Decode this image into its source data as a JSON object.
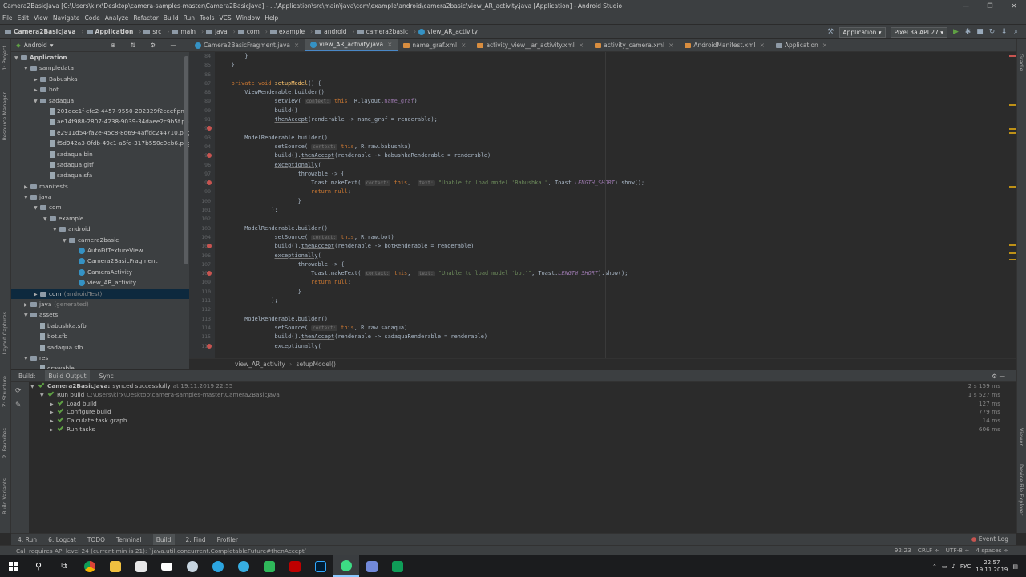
{
  "window": {
    "title": "Camera2BasicJava [C:\\Users\\kirx\\Desktop\\camera-samples-master\\Camera2BasicJava] - ...\\Application\\src\\main\\java\\com\\example\\android\\camera2basic\\view_AR_activity.java [Application] - Android Studio"
  },
  "menu": [
    "File",
    "Edit",
    "View",
    "Navigate",
    "Code",
    "Analyze",
    "Refactor",
    "Build",
    "Run",
    "Tools",
    "VCS",
    "Window",
    "Help"
  ],
  "nav": {
    "crumbs": [
      "Camera2BasicJava",
      "Application",
      "src",
      "main",
      "java",
      "com",
      "example",
      "android",
      "camera2basic",
      "view_AR_activity"
    ]
  },
  "run": {
    "config": "Application",
    "device": "Pixel 3a API 27"
  },
  "project": {
    "view": "Android"
  },
  "tree": [
    {
      "t": "Application",
      "d": 0,
      "a": "▼",
      "bold": true
    },
    {
      "t": "sampledata",
      "d": 1,
      "a": "▼"
    },
    {
      "t": "Babushka",
      "d": 2,
      "a": "▶"
    },
    {
      "t": "bot",
      "d": 2,
      "a": "▶"
    },
    {
      "t": "sadaqua",
      "d": 2,
      "a": "▼"
    },
    {
      "t": "201dcc1f-efe2-4457-9550-202329f2ceef.png",
      "d": 3,
      "a": ""
    },
    {
      "t": "ae14f988-2807-4238-9039-34daee2c9b5f.png",
      "d": 3,
      "a": ""
    },
    {
      "t": "e2911d54-fa2e-45c8-8d69-4affdc244710.png",
      "d": 3,
      "a": ""
    },
    {
      "t": "f5d942a3-0fdb-49c1-a6fd-317b550c0eb6.png",
      "d": 3,
      "a": ""
    },
    {
      "t": "sadaqua.bin",
      "d": 3,
      "a": ""
    },
    {
      "t": "sadaqua.gltf",
      "d": 3,
      "a": ""
    },
    {
      "t": "sadaqua.sfa",
      "d": 3,
      "a": ""
    },
    {
      "t": "manifests",
      "d": 1,
      "a": "▶"
    },
    {
      "t": "java",
      "d": 1,
      "a": "▼"
    },
    {
      "t": "com",
      "d": 2,
      "a": "▼"
    },
    {
      "t": "example",
      "d": 3,
      "a": "▼"
    },
    {
      "t": "android",
      "d": 4,
      "a": "▼"
    },
    {
      "t": "camera2basic",
      "d": 5,
      "a": "▼"
    },
    {
      "t": "AutoFitTextureView",
      "d": 6,
      "a": ""
    },
    {
      "t": "Camera2BasicFragment",
      "d": 6,
      "a": ""
    },
    {
      "t": "CameraActivity",
      "d": 6,
      "a": ""
    },
    {
      "t": "view_AR_activity",
      "d": 6,
      "a": ""
    },
    {
      "t": "com",
      "s": "(androidTest)",
      "d": 2,
      "a": "▶",
      "sel": true
    },
    {
      "t": "java",
      "s": "(generated)",
      "d": 1,
      "a": "▶"
    },
    {
      "t": "assets",
      "d": 1,
      "a": "▼"
    },
    {
      "t": "babushka.sfb",
      "d": 2,
      "a": ""
    },
    {
      "t": "bot.sfb",
      "d": 2,
      "a": ""
    },
    {
      "t": "sadaqua.sfb",
      "d": 2,
      "a": ""
    },
    {
      "t": "res",
      "d": 1,
      "a": "▼"
    },
    {
      "t": "drawable",
      "d": 2,
      "a": ""
    }
  ],
  "tabs": [
    {
      "label": "Camera2BasicFragment.java",
      "active": false
    },
    {
      "label": "view_AR_activity.java",
      "active": true
    },
    {
      "label": "name_graf.xml",
      "active": false
    },
    {
      "label": "activity_view__ar_activity.xml",
      "active": false
    },
    {
      "label": "activity_camera.xml",
      "active": false
    },
    {
      "label": "AndroidManifest.xml",
      "active": false
    },
    {
      "label": "Application",
      "active": false
    }
  ],
  "lines": [
    "84",
    "85",
    "86",
    "87",
    "88",
    "89",
    "90",
    "91",
    "92",
    "93",
    "94",
    "95",
    "96",
    "97",
    "98",
    "99",
    "100",
    "101",
    "102",
    "103",
    "104",
    "105",
    "106",
    "107",
    "108",
    "109",
    "110",
    "111",
    "112",
    "113",
    "114",
    "115",
    "116"
  ],
  "code": [
    "        }",
    "    }",
    "",
    "    private void setupModel() {",
    "        ViewRenderable.builder()",
    "                .setView( context: this, R.layout.name_graf)",
    "                .build()",
    "                .thenAccept(renderable -> name_graf = renderable);",
    "",
    "        ModelRenderable.builder()",
    "                .setSource( context: this, R.raw.babushka)",
    "                .build().thenAccept(renderable -> babushkaRenderable = renderable)",
    "                .exceptionally(",
    "                        throwable -> {",
    "                            Toast.makeText( context: this,  text: \"Unable to load model 'Babushka'\", Toast.LENGTH_SHORT).show();",
    "                            return null;",
    "                        }",
    "                );",
    "",
    "        ModelRenderable.builder()",
    "                .setSource( context: this, R.raw.bot)",
    "                .build().thenAccept(renderable -> botRenderable = renderable)",
    "                .exceptionally(",
    "                        throwable -> {",
    "                            Toast.makeText( context: this,  text: \"Unable to load model 'bot'\", Toast.LENGTH_SHORT).show();",
    "                            return null;",
    "                        }",
    "                );",
    "",
    "        ModelRenderable.builder()",
    "                .setSource( context: this, R.raw.sadaqua)",
    "                .build().thenAccept(renderable -> sadaquaRenderable = renderable)",
    "                .exceptionally("
  ],
  "editorCrumb": [
    "view_AR_activity",
    "setupModel()"
  ],
  "build": {
    "tabs": [
      "Build:",
      "Build Output",
      "Sync"
    ],
    "rows": [
      {
        "t": "Camera2BasicJava:",
        "s": "synced successfully",
        "g": "at 19.11.2019 22:55",
        "time": "2 s 159 ms",
        "d": 0
      },
      {
        "t": "Run build",
        "g": "C:\\Users\\kirx\\Desktop\\camera-samples-master\\Camera2BasicJava",
        "time": "1 s 527 ms",
        "d": 1
      },
      {
        "t": "Load build",
        "time": "127 ms",
        "d": 2
      },
      {
        "t": "Configure build",
        "time": "779 ms",
        "d": 2
      },
      {
        "t": "Calculate task graph",
        "time": "14 ms",
        "d": 2
      },
      {
        "t": "Run tasks",
        "time": "606 ms",
        "d": 2
      }
    ]
  },
  "bottomTabs": [
    "4: Run",
    "6: Logcat",
    "TODO",
    "Terminal",
    "Build",
    "2: Find",
    "Profiler"
  ],
  "eventLog": "Event Log",
  "status": {
    "msg": "Call requires API level 24 (current min is 21): `java.util.concurrent.CompletableFuture#thenAccept`",
    "pos": "92:23",
    "crlf": "CRLF ÷",
    "enc": "UTF-8 ÷",
    "indent": "4 spaces ÷"
  },
  "leftTabs": [
    "1: Project",
    "Resource Manager",
    "Layout Captures",
    "Z: Structure",
    "2: Favorites",
    "Build Variants"
  ],
  "rightTabs": [
    "Gradle",
    "Viewer",
    "Device File Explorer"
  ],
  "tray": {
    "lang": "РУС",
    "time": "22:57",
    "date": "19.11.2019"
  }
}
